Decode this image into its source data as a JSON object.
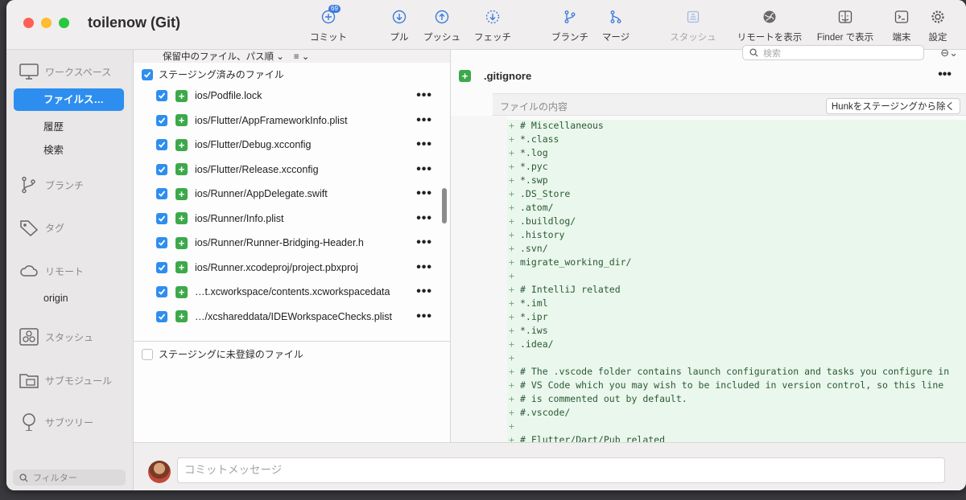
{
  "window": {
    "title": "toilenow (Git)"
  },
  "toolbar": {
    "commit_label": "コミット",
    "commit_badge": "69",
    "pull_label": "プル",
    "push_label": "プッシュ",
    "fetch_label": "フェッチ",
    "branch_label": "ブランチ",
    "merge_label": "マージ",
    "stash_label": "スタッシュ",
    "remote_label": "リモートを表示",
    "finder_label": "Finder で表示",
    "terminal_label": "端末",
    "settings_label": "設定"
  },
  "sidebar": {
    "workspace": "ワークスペース",
    "file_status": "ファイルス…",
    "history": "履歴",
    "search": "検索",
    "branches": "ブランチ",
    "tags": "タグ",
    "remotes": "リモート",
    "origin": "origin",
    "stashes": "スタッシュ",
    "submodules": "サブモジュール",
    "subtrees": "サブツリー",
    "filter_placeholder": "フィルター"
  },
  "filepane": {
    "sort_label": "保留中のファイル、パス順",
    "staged_header": "ステージング済みのファイル",
    "unstaged_header": "ステージングに未登録のファイル",
    "files": [
      "ios/Podfile.lock",
      "ios/Flutter/AppFrameworkInfo.plist",
      "ios/Flutter/Debug.xcconfig",
      "ios/Flutter/Release.xcconfig",
      "ios/Runner/AppDelegate.swift",
      "ios/Runner/Info.plist",
      "ios/Runner/Runner-Bridging-Header.h",
      "ios/Runner.xcodeproj/project.pbxproj",
      "…t.xcworkspace/contents.xcworkspacedata",
      "…/xcshareddata/IDEWorkspaceChecks.plist"
    ]
  },
  "diff": {
    "search_placeholder": "検索",
    "file_name": ".gitignore",
    "hunk_label": "ファイルの内容",
    "unstage_hunk": "Hunkをステージングから除く",
    "lines": [
      "# Miscellaneous",
      "*.class",
      "*.log",
      "*.pyc",
      "*.swp",
      ".DS_Store",
      ".atom/",
      ".buildlog/",
      ".history",
      ".svn/",
      "migrate_working_dir/",
      "",
      "# IntelliJ related",
      "*.iml",
      "*.ipr",
      "*.iws",
      ".idea/",
      "",
      "# The .vscode folder contains launch configuration and tasks you configure in",
      "# VS Code which you may wish to be included in version control, so this line",
      "# is commented out by default.",
      "#.vscode/",
      "",
      "# Flutter/Dart/Pub related"
    ]
  },
  "commit": {
    "placeholder": "コミットメッセージ"
  }
}
